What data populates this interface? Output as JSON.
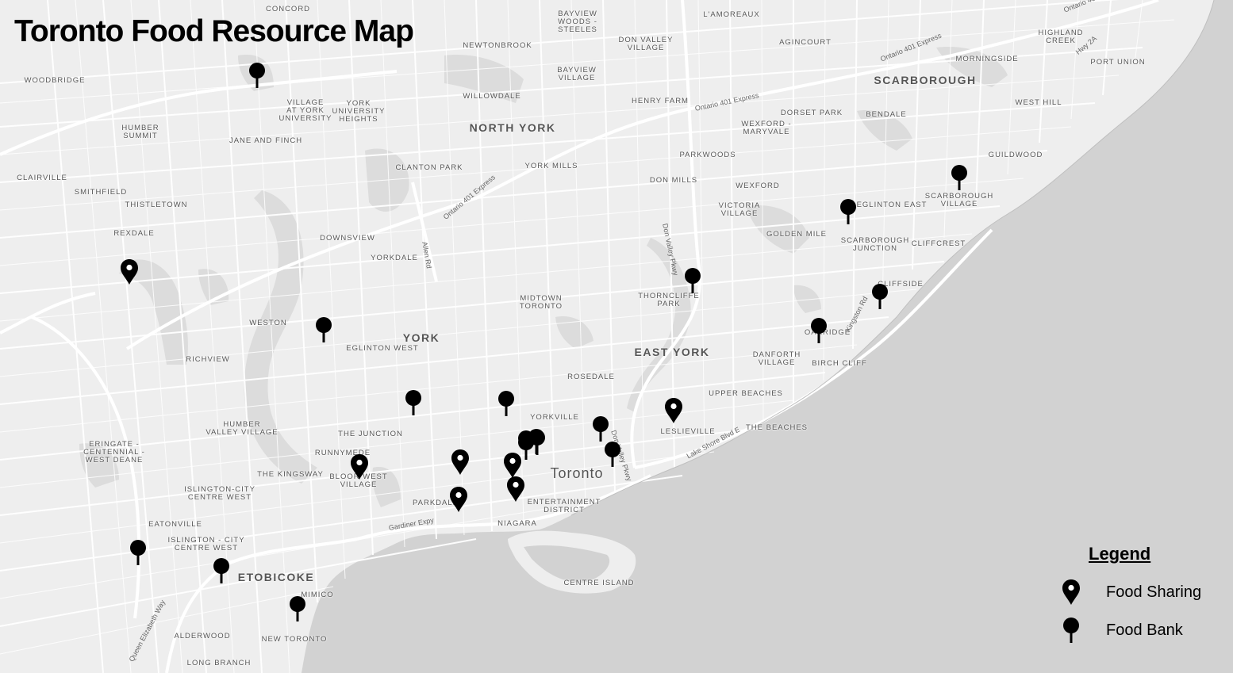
{
  "title": "Toronto Food Resource Map",
  "colors": {
    "water": "#d2d2d2",
    "land": "#eeeeee",
    "road": "#ffffff",
    "park": "#dcdcdc",
    "marker": "#000000"
  },
  "labels": {
    "concord": "CONCORD",
    "bayview_woods": "BAYVIEW\nWOODS -\nSTEELES",
    "lamoreaux": "L'AMOREAUX",
    "highland_creek": "HIGHLAND\nCREEK",
    "port_union": "PORT UNION",
    "agincourt": "AGINCOURT",
    "newtonbrook": "NEWTONBROOK",
    "don_valley_village": "DON VALLEY\nVILLAGE",
    "woodbridge": "WOODBRIDGE",
    "morningside": "MORNINGSIDE",
    "bayview_village": "BAYVIEW\nVILLAGE",
    "willowdale": "WILLOWDALE",
    "henry_farm": "HENRY FARM",
    "village_york_university": "VILLAGE\nAT YORK\nUNIVERSITY",
    "york_university_heights": "YORK\nUNIVERSITY\nHEIGHTS",
    "west_hill": "WEST HILL",
    "dorset_park": "DORSET PARK",
    "bendale": "BENDALE",
    "humber_summit": "HUMBER\nSUMMIT",
    "wexford_maryvale": "WEXFORD -\nMARYVALE",
    "jane_and_finch": "JANE AND FINCH",
    "parkwoods": "PARKWOODS",
    "guildwood": "GUILDWOOD",
    "clanton_park": "CLANTON PARK",
    "york_mills": "YORK MILLS",
    "clairville": "CLAIRVILLE",
    "don_mills": "DON MILLS",
    "wexford": "WEXFORD",
    "smithfield": "SMITHFIELD",
    "scarborough_village": "SCARBOROUGH\nVILLAGE",
    "thistletown": "THISTLETOWN",
    "victoria_village": "VICTORIA\nVILLAGE",
    "eglinton_east": "EGLINTON EAST",
    "rexdale": "REXDALE",
    "golden_mile": "GOLDEN MILE",
    "downsview": "DOWNSVIEW",
    "scarborough_junction": "SCARBOROUGH\nJUNCTION",
    "cliffcrest": "CLIFFCREST",
    "yorkdale": "YORKDALE",
    "cliffside": "CLIFFSIDE",
    "thorncliffe_park": "THORNCLIFFE\nPARK",
    "midtown_toronto": "MIDTOWN\nTORONTO",
    "weston": "WESTON",
    "oakridge": "OAKRIDGE",
    "eglinton_west": "EGLINTON WEST",
    "danforth_village": "DANFORTH\nVILLAGE",
    "richview": "RICHVIEW",
    "birch_cliff": "BIRCH CLIFF",
    "rosedale": "ROSEDALE",
    "upper_beaches": "UPPER BEACHES",
    "yorkville": "YORKVILLE",
    "humber_valley_village": "HUMBER\nVALLEY VILLAGE",
    "the_junction": "THE JUNCTION",
    "leslieville": "LESLIEVILLE",
    "the_beaches": "THE BEACHES",
    "eringate": "ERINGATE -\nCENTENNIAL -\nWEST DEANE",
    "runnymede": "RUNNYMEDE",
    "the_kingsway": "THE KINGSWAY",
    "bloor_west_village": "BLOOR WEST\nVILLAGE",
    "islington_city_centre_west_1": "ISLINGTON-CITY\nCENTRE WEST",
    "parkdale": "PARKDALE",
    "entertainment_district": "ENTERTAINMENT\nDISTRICT",
    "niagara": "NIAGARA",
    "eatonville": "EATONVILLE",
    "islington_city_centre_west_2": "ISLINGTON - CITY\nCENTRE WEST",
    "centre_island": "CENTRE ISLAND",
    "mimico": "MIMICO",
    "alderwood": "ALDERWOOD",
    "new_toronto": "NEW TORONTO",
    "long_branch": "LONG BRANCH"
  },
  "districts": {
    "scarborough": "SCARBOROUGH",
    "north_york": "NORTH YORK",
    "york": "YORK",
    "east_york": "EAST YORK",
    "etobicoke": "ETOBICOKE"
  },
  "city_label": "Toronto",
  "roads": {
    "ontario_401_express_1": "Ontario 401 Express",
    "ontario_401_express_2": "Ontario 401 Express",
    "ontario_401_express_3": "Ontario 401 Express",
    "ontario_401_express_4": "Ontario 401 Express",
    "hwy_2a": "Hwy 2A",
    "allen_rd": "Allen Rd",
    "don_valley_pkwy_1": "Don Valley Pkwy",
    "don_valley_pkwy_2": "Don Valley Pkwy",
    "kingston_rd": "Kingston Rd",
    "lake_shore_blvd_e": "Lake Shore Blvd E",
    "gardiner_expy": "Gardiner Expy",
    "queen_elizabeth_way": "Queen Elizabeth Way"
  },
  "markers": [
    {
      "type": "food_bank"
    },
    {
      "type": "food_sharing"
    },
    {
      "type": "food_bank"
    },
    {
      "type": "food_bank"
    },
    {
      "type": "food_bank"
    },
    {
      "type": "food_bank"
    },
    {
      "type": "food_bank"
    },
    {
      "type": "food_bank"
    },
    {
      "type": "food_sharing"
    },
    {
      "type": "food_sharing"
    },
    {
      "type": "food_sharing"
    },
    {
      "type": "food_sharing"
    },
    {
      "type": "food_sharing"
    },
    {
      "type": "food_bank"
    },
    {
      "type": "food_bank"
    },
    {
      "type": "food_bank"
    },
    {
      "type": "food_bank"
    },
    {
      "type": "food_bank"
    },
    {
      "type": "food_bank"
    },
    {
      "type": "food_sharing"
    },
    {
      "type": "food_bank"
    },
    {
      "type": "food_bank"
    },
    {
      "type": "food_bank"
    },
    {
      "type": "food_bank"
    },
    {
      "type": "food_bank"
    }
  ],
  "legend": {
    "title": "Legend",
    "food_sharing": "Food Sharing",
    "food_bank": "Food Bank"
  }
}
